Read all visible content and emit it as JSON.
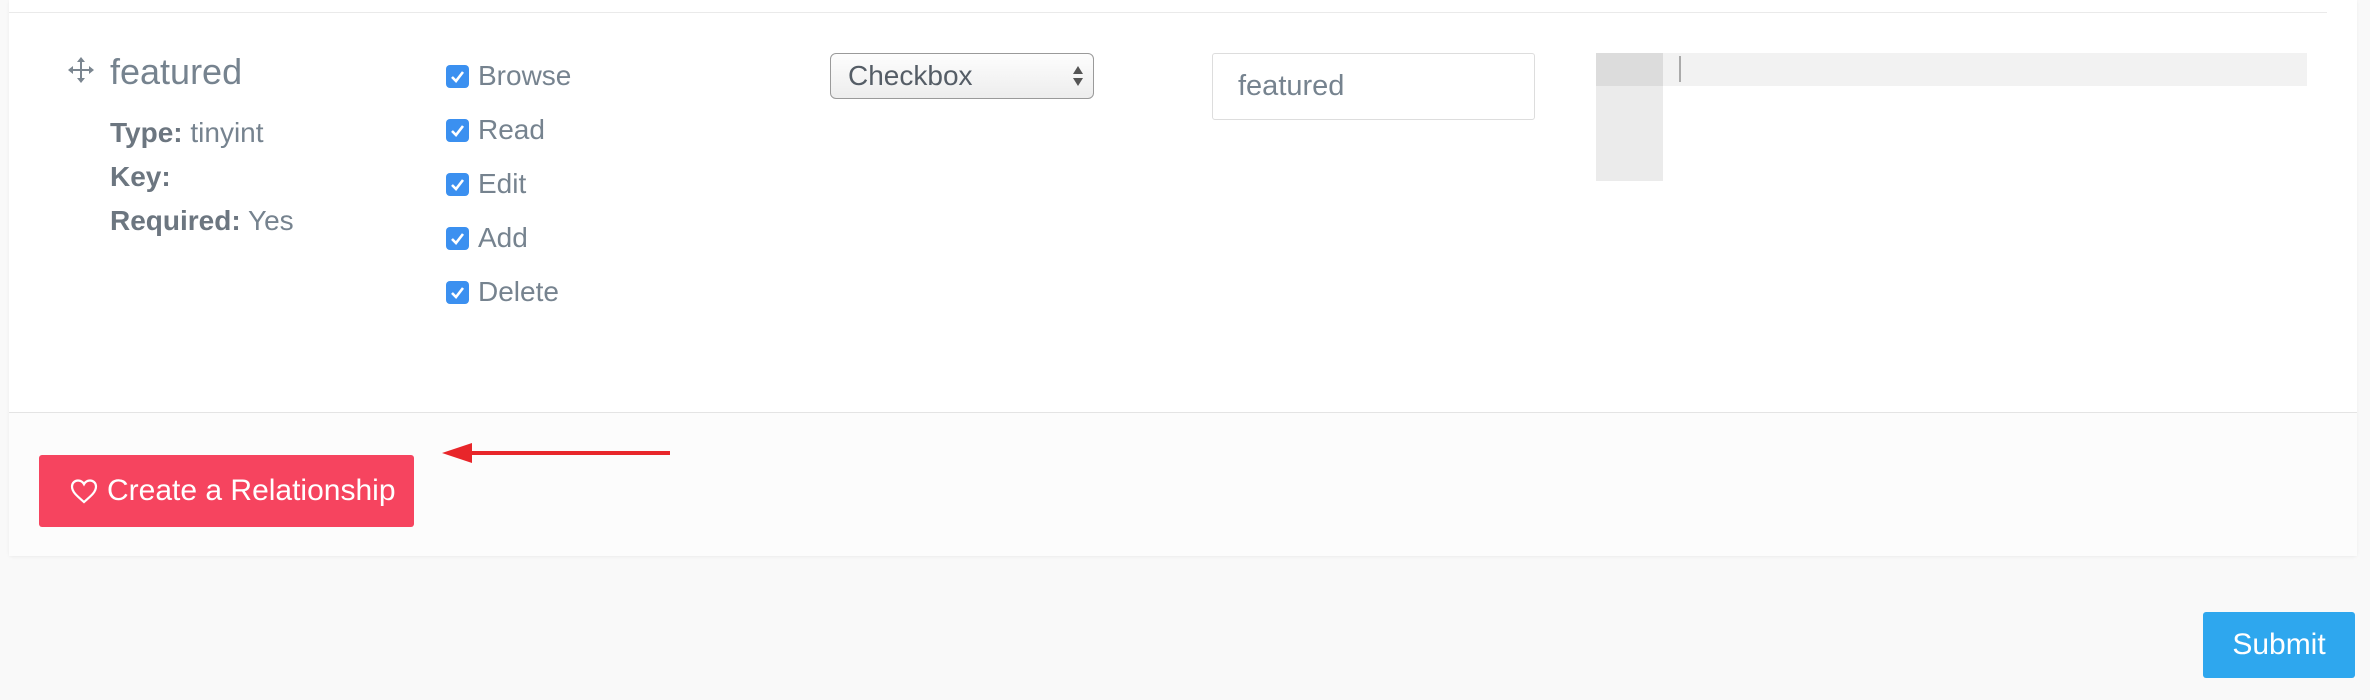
{
  "field": {
    "name": "featured",
    "type_label": "Type:",
    "type_value": "tinyint",
    "key_label": "Key:",
    "key_value": "",
    "required_label": "Required:",
    "required_value": "Yes"
  },
  "permissions": [
    {
      "label": "Browse",
      "checked": true
    },
    {
      "label": "Read",
      "checked": true
    },
    {
      "label": "Edit",
      "checked": true
    },
    {
      "label": "Add",
      "checked": true
    },
    {
      "label": "Delete",
      "checked": true
    }
  ],
  "input_type": {
    "selected": "Checkbox"
  },
  "display_name": {
    "value": "featured"
  },
  "relationship_button": {
    "label": "Create a Relationship",
    "icon": "heart-outline-icon"
  },
  "submit_button": {
    "label": "Submit"
  },
  "colors": {
    "relationship_button": "#f6445f",
    "submit_button": "#2ea7ee",
    "checkbox": "#3b90f0",
    "annotation_arrow": "#e8262a"
  }
}
